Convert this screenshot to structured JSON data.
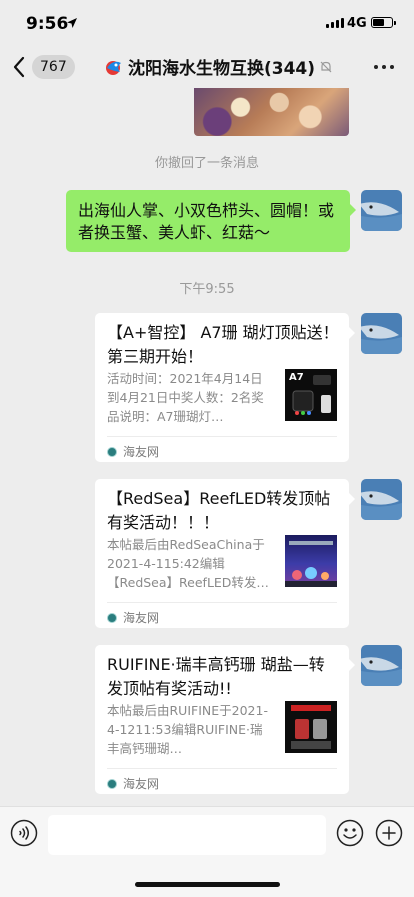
{
  "status": {
    "time": "9:56",
    "network": "4G"
  },
  "nav": {
    "unread_count": "767",
    "title": "沈阳海水生物互换(344)"
  },
  "system": {
    "recalled": "你撤回了一条消息",
    "timestamp": "下午9:55"
  },
  "own_message": {
    "text": "出海仙人掌、小双色栉头、圆帽！或者换玉蟹、美人虾、红菇～"
  },
  "cards": [
    {
      "title": "【A+智控】 A7珊 瑚灯顶贴送！第三期开始！",
      "desc": "活动时间：2021年4月14日到4月21日中奖人数：2名奖品说明：A7珊瑚灯…",
      "thumb_label": "A7",
      "source": "海友网"
    },
    {
      "title": "【RedSea】ReefLED转发顶帖有奖活动！！！",
      "desc": "本帖最后由RedSeaChina于2021-4-115:42编辑【RedSea】ReefLED转发…",
      "source": "海友网"
    },
    {
      "title": "RUIFINE·瑞丰高钙珊 瑚盐—转发顶帖有奖活动!!",
      "desc": "本帖最后由RUIFINE于2021-4-1211:53编辑RUIFINE·瑞丰高钙珊瑚…",
      "source": "海友网"
    }
  ],
  "colors": {
    "bubble_green": "#95ec69",
    "background": "#ededed"
  }
}
